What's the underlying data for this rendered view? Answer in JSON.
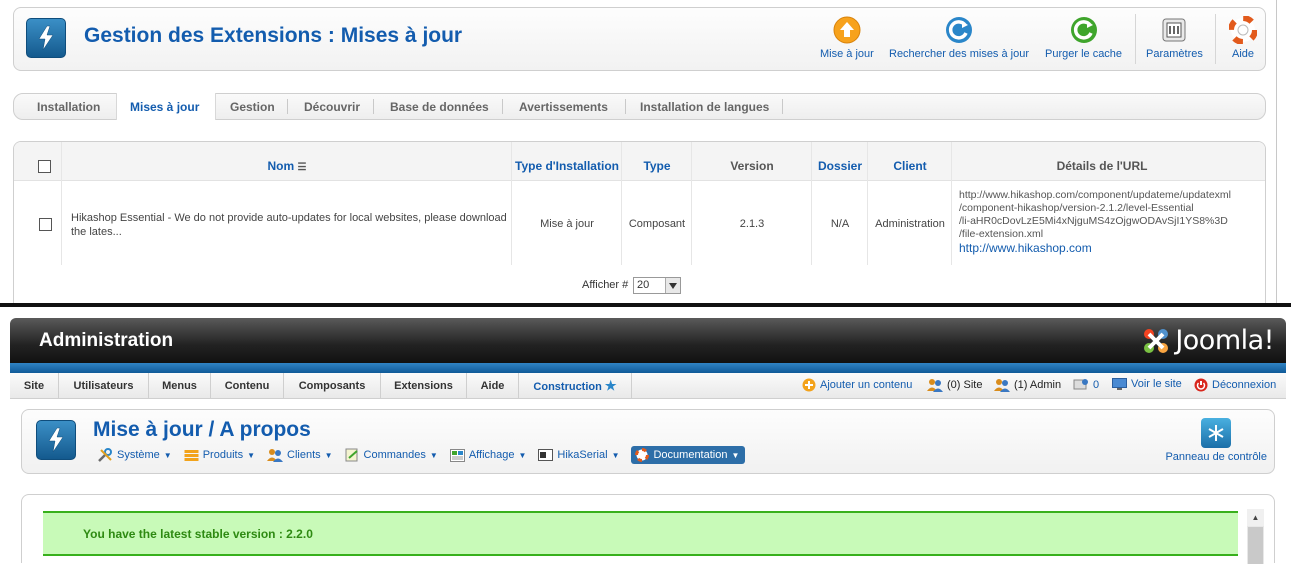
{
  "top": {
    "title": "Gestion des Extensions : Mises à jour",
    "toolbar": {
      "update": "Mise à jour",
      "find_updates": "Rechercher des mises à jour",
      "purge_cache": "Purger le cache",
      "options": "Paramètres",
      "help": "Aide"
    },
    "tabs": [
      "Installation",
      "Mises à jour",
      "Gestion",
      "Découvrir",
      "Base de données",
      "Avertissements",
      "Installation de langues"
    ],
    "table": {
      "headers": {
        "name": "Nom",
        "install_type": "Type d'Installation",
        "type": "Type",
        "version": "Version",
        "folder": "Dossier",
        "client": "Client",
        "url_details": "Détails de l'URL"
      },
      "row": {
        "name": "Hikashop Essential - We do not provide auto-updates for local websites, please download the lates...",
        "install_type": "Mise à jour",
        "type": "Composant",
        "version": "2.1.3",
        "folder": "N/A",
        "client": "Administration",
        "url_lines": [
          "http://www.hikashop.com/component/updateme/updatexml",
          "/component-hikashop/version-2.1.2/level-Essential",
          "/li-aHR0cDovLzE5Mi4xNjguMS4zOjgwODAvSjI1YS8%3D",
          "/file-extension.xml"
        ],
        "url_link": "http://www.hikashop.com"
      },
      "footer": {
        "display_label": "Afficher #",
        "display_value": "20"
      }
    }
  },
  "bottom": {
    "admin_title": "Administration",
    "joomla_word": "Joomla!",
    "menu": [
      "Site",
      "Utilisateurs",
      "Menus",
      "Contenu",
      "Composants",
      "Extensions",
      "Aide",
      "Construction"
    ],
    "status": {
      "add_content": "Ajouter un contenu",
      "site_users": "(0) Site",
      "admin_users": "(1) Admin",
      "messages": "0",
      "view_site": "Voir le site",
      "logout": "Déconnexion"
    },
    "page_title": "Mise à jour / A propos",
    "submenu": [
      "Système",
      "Produits",
      "Clients",
      "Commandes",
      "Affichage",
      "HikaSerial",
      "Documentation"
    ],
    "control_panel": "Panneau de contrôle",
    "message": "You have the latest stable version : 2.2.0"
  },
  "colors": {
    "brand_blue": "#135cae",
    "success_bg": "#c8fab8",
    "success_border": "#38b01c"
  }
}
